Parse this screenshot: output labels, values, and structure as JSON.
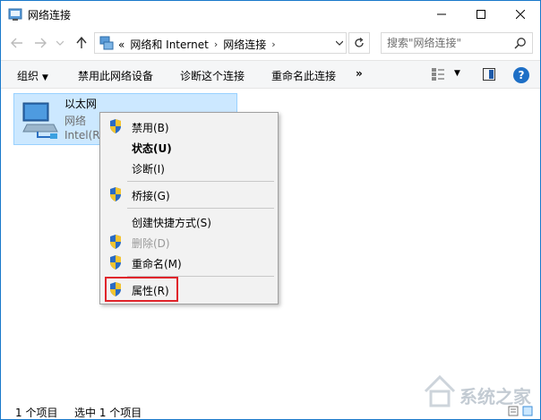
{
  "window": {
    "title": "网络连接",
    "minimize_icon": "minimize-icon",
    "maximize_icon": "maximize-icon",
    "close_icon": "close-icon"
  },
  "address_bar": {
    "overflow": "«",
    "crumbs": [
      "网络和 Internet",
      "网络连接"
    ],
    "separator": "›"
  },
  "search": {
    "placeholder": "搜索\"网络连接\""
  },
  "toolbar": {
    "organize": "组织",
    "disable_device": "禁用此网络设备",
    "diagnose": "诊断这个连接",
    "rename": "重命名此连接",
    "more": "»"
  },
  "item": {
    "name": "以太网",
    "type": "网络",
    "device": "Intel(R"
  },
  "context_menu": {
    "items": [
      {
        "label": "禁用(B)",
        "shield": true
      },
      {
        "label": "状态(U)",
        "shield": false,
        "bold": true
      },
      {
        "label": "诊断(I)",
        "shield": false
      },
      {
        "label": "桥接(G)",
        "shield": true
      },
      {
        "label": "创建快捷方式(S)",
        "shield": false
      },
      {
        "label": "删除(D)",
        "shield": true,
        "disabled": true
      },
      {
        "label": "重命名(M)",
        "shield": true
      },
      {
        "label": "属性(R)",
        "shield": true,
        "highlighted": true
      }
    ]
  },
  "status": {
    "count": "1 个项目",
    "selected": "选中 1 个项目"
  },
  "watermark": {
    "text": "系统之家"
  },
  "colors": {
    "accent": "#1979ca",
    "selection": "#cce8ff",
    "highlight_box": "#e0242b"
  }
}
